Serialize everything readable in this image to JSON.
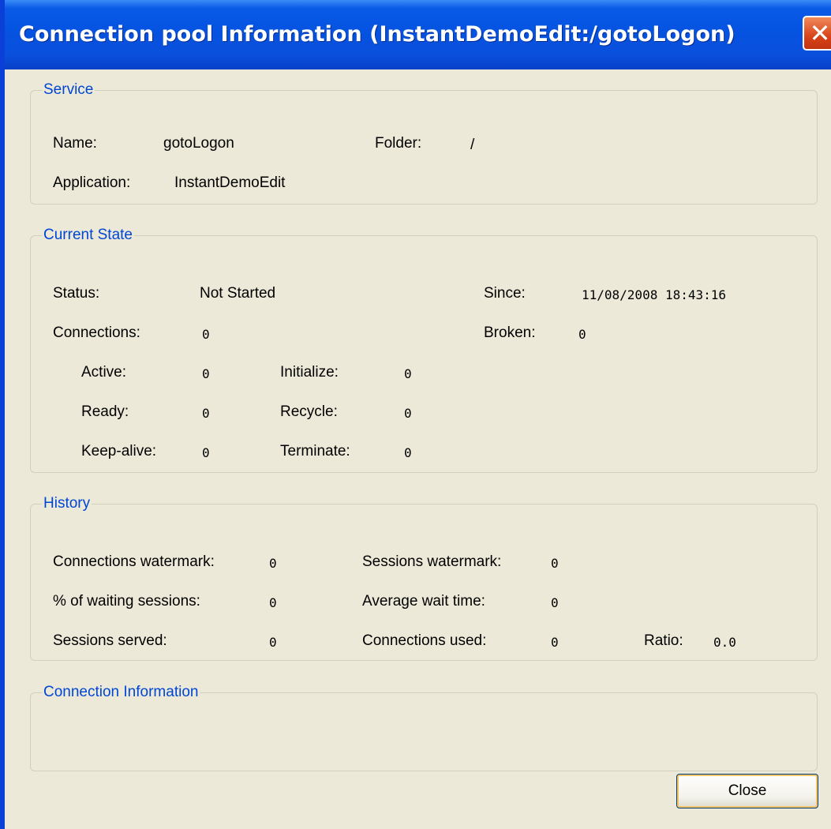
{
  "window": {
    "title": "Connection pool Information (InstantDemoEdit:/gotoLogon)",
    "close_glyph": "✕"
  },
  "service": {
    "legend": "Service",
    "name_label": "Name:",
    "name_value": "gotoLogon",
    "folder_label": "Folder:",
    "folder_value": "/",
    "application_label": "Application:",
    "application_value": "InstantDemoEdit"
  },
  "current_state": {
    "legend": "Current State",
    "status_label": "Status:",
    "status_value": "Not Started",
    "since_label": "Since:",
    "since_value": "11/08/2008 18:43:16",
    "connections_label": "Connections:",
    "connections_value": "0",
    "broken_label": "Broken:",
    "broken_value": "0",
    "active_label": "Active:",
    "active_value": "0",
    "initialize_label": "Initialize:",
    "initialize_value": "0",
    "ready_label": "Ready:",
    "ready_value": "0",
    "recycle_label": "Recycle:",
    "recycle_value": "0",
    "keepalive_label": "Keep-alive:",
    "keepalive_value": "0",
    "terminate_label": "Terminate:",
    "terminate_value": "0"
  },
  "history": {
    "legend": "History",
    "conn_watermark_label": "Connections watermark:",
    "conn_watermark_value": "0",
    "sess_watermark_label": "Sessions watermark:",
    "sess_watermark_value": "0",
    "waiting_label": "% of waiting sessions:",
    "waiting_value": "0",
    "avg_wait_label": "Average wait time:",
    "avg_wait_value": "0",
    "served_label": "Sessions served:",
    "served_value": "0",
    "used_label": "Connections used:",
    "used_value": "0",
    "ratio_label": "Ratio:",
    "ratio_value": "0.0"
  },
  "connection_info": {
    "legend": "Connection Information"
  },
  "buttons": {
    "close_label": "Close"
  },
  "colors": {
    "title_bar": "#0553e0",
    "window_bg": "#ece9d8",
    "legend_text": "#0046d5",
    "close_button": "#d8441a"
  }
}
